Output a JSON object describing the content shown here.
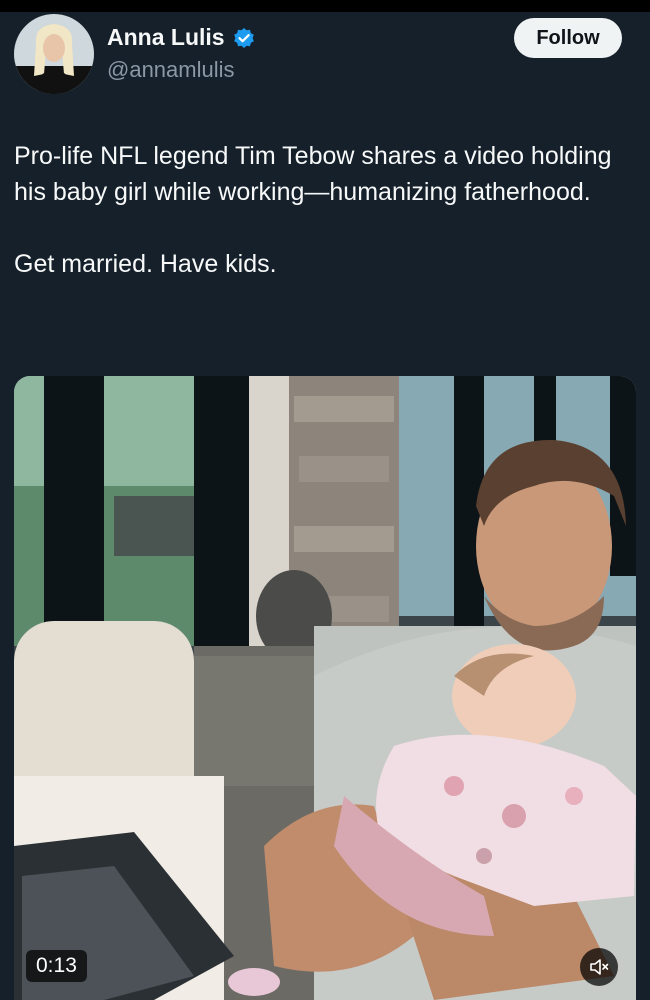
{
  "author": {
    "display_name": "Anna Lulis",
    "handle": "@annamlulis",
    "verified": true,
    "avatar": "user-avatar"
  },
  "actions": {
    "follow_label": "Follow"
  },
  "tweet": {
    "paragraphs": [
      "Pro-life NFL legend Tim Tebow shares a video holding his baby girl while working—humanizing fatherhood.",
      "Get married. Have kids."
    ]
  },
  "media": {
    "type": "video",
    "timestamp": "0:13",
    "muted": true,
    "icons": {
      "mute": "speaker-muted-icon"
    }
  },
  "colors": {
    "background": "#15202b",
    "verified": "#1d9bf0",
    "secondary_text": "#8b98a5"
  }
}
